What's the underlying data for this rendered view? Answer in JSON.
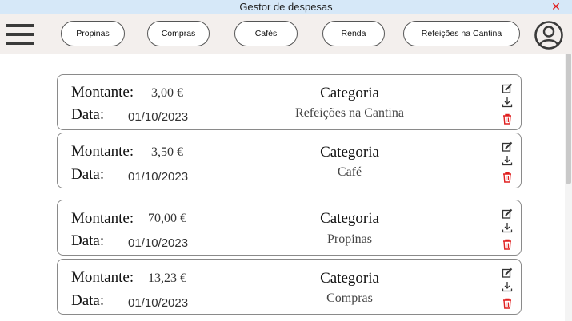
{
  "window": {
    "title": "Gestor de despesas",
    "close": "✕"
  },
  "header": {
    "menu_icon": "hamburger-menu-icon",
    "chips": [
      "Propinas",
      "Compras",
      "Cafés",
      "Renda",
      "Refeições na Cantina"
    ],
    "profile_icon": "user-profile-icon"
  },
  "labels": {
    "amount": "Montante:",
    "date": "Data:",
    "category": "Categoria"
  },
  "expenses": [
    {
      "amount": "3,00 €",
      "date": "01/10/2023",
      "category": "Refeições na Cantina"
    },
    {
      "amount": "3,50 €",
      "date": "01/10/2023",
      "category": "Café"
    },
    {
      "amount": "70,00 €",
      "date": "01/10/2023",
      "category": "Propinas"
    },
    {
      "amount": "13,23 €",
      "date": "01/10/2023",
      "category": "Compras"
    }
  ],
  "card_icons": [
    "edit-icon",
    "download-icon",
    "delete-icon"
  ],
  "colors": {
    "titlebar": "#d6e8f8",
    "header": "#f3efed",
    "delete": "#e02020",
    "close": "#e01818"
  }
}
